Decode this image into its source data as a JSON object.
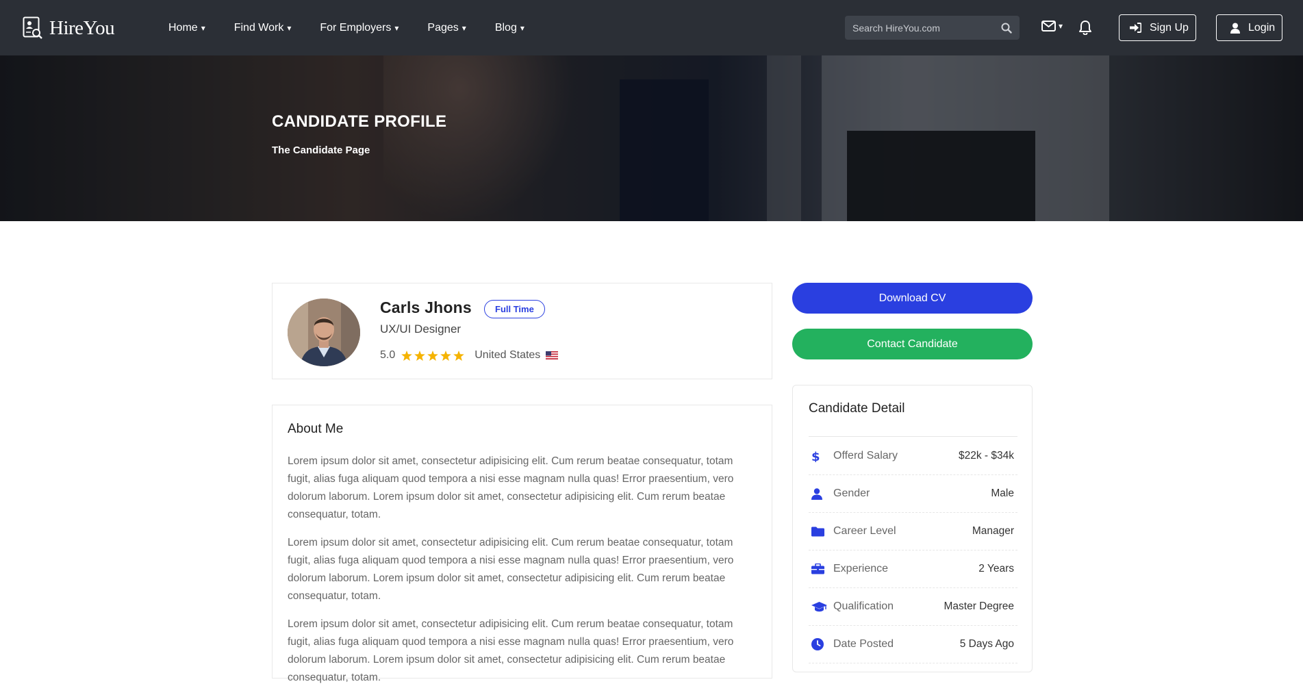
{
  "brand": {
    "name": "HireYou"
  },
  "nav": {
    "items": [
      {
        "label": "Home"
      },
      {
        "label": "Find Work"
      },
      {
        "label": "For Employers"
      },
      {
        "label": "Pages"
      },
      {
        "label": "Blog"
      }
    ],
    "caret": "▾",
    "search_placeholder": "Search HireYou.com",
    "signup_label": "Sign Up",
    "login_label": "Login"
  },
  "hero": {
    "title": "CANDIDATE PROFILE",
    "subtitle": "The Candidate Page"
  },
  "candidate": {
    "name": "Carls Jhons",
    "badge": "Full Time",
    "title": "UX/UI Designer",
    "rating": "5.0",
    "stars": 5,
    "country": "United States"
  },
  "about": {
    "title": "About Me",
    "paragraphs": [
      "Lorem ipsum dolor sit amet, consectetur adipisicing elit. Cum rerum beatae consequatur, totam fugit, alias fuga aliquam quod tempora a nisi esse magnam nulla quas! Error praesentium, vero dolorum laborum. Lorem ipsum dolor sit amet, consectetur adipisicing elit. Cum rerum beatae consequatur, totam.",
      "Lorem ipsum dolor sit amet, consectetur adipisicing elit. Cum rerum beatae consequatur, totam fugit, alias fuga aliquam quod tempora a nisi esse magnam nulla quas! Error praesentium, vero dolorum laborum. Lorem ipsum dolor sit amet, consectetur adipisicing elit. Cum rerum beatae consequatur, totam.",
      "Lorem ipsum dolor sit amet, consectetur adipisicing elit. Cum rerum beatae consequatur, totam fugit, alias fuga aliquam quod tempora a nisi esse magnam nulla quas! Error praesentium, vero dolorum laborum. Lorem ipsum dolor sit amet, consectetur adipisicing elit. Cum rerum beatae consequatur, totam."
    ]
  },
  "actions": {
    "download_label": "Download CV",
    "contact_label": "Contact Candidate"
  },
  "details": {
    "title": "Candidate Detail",
    "rows": [
      {
        "icon": "dollar-icon",
        "label": "Offerd Salary",
        "value": "$22k - $34k"
      },
      {
        "icon": "user-icon",
        "label": "Gender",
        "value": "Male"
      },
      {
        "icon": "folder-icon",
        "label": "Career Level",
        "value": "Manager"
      },
      {
        "icon": "briefcase-icon",
        "label": "Experience",
        "value": "2 Years"
      },
      {
        "icon": "graduation-cap-icon",
        "label": "Qualification",
        "value": "Master Degree"
      },
      {
        "icon": "clock-icon",
        "label": "Date Posted",
        "value": "5 Days Ago"
      }
    ]
  },
  "colors": {
    "navbar": "#2b2f36",
    "primary": "#2a3fe0",
    "success": "#23b15e",
    "star": "#f5b301"
  }
}
